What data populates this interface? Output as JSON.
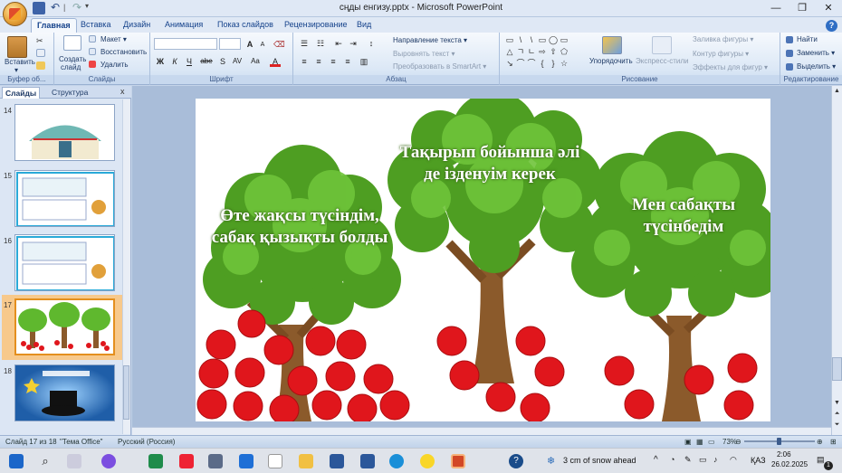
{
  "window": {
    "title": "сңды енгизу.pptx - Microsoft PowerPoint",
    "controls": [
      "—",
      "❐",
      "✕"
    ]
  },
  "quick_access": {
    "separator": "|",
    "more": "▾"
  },
  "tabs": [
    "Главная",
    "Вставка",
    "Дизайн",
    "Анимация",
    "Показ слайдов",
    "Рецензирование",
    "Вид"
  ],
  "active_tab": "Главная",
  "help": "?",
  "ribbon": {
    "clipboard": {
      "label": "Буфер об...",
      "paste": "Вставить",
      "paste_arrow": "▾"
    },
    "slides": {
      "label": "Слайды",
      "new_slide": "Создать",
      "new_slide_2": "слайд",
      "layout": "Макет ▾",
      "reset": "Восстановить",
      "delete": "Удалить"
    },
    "font": {
      "label": "Шрифт",
      "grow": "A",
      "shrink": "A",
      "bold": "Ж",
      "italic": "К",
      "underline": "Ч",
      "strike": "abe",
      "shadow": "S",
      "spacing": "AV",
      "case": "Aa",
      "color": "A"
    },
    "paragraph": {
      "label": "Абзац",
      "direction": "Направление текста ▾",
      "align_text": "Выровнять текст ▾",
      "smartart": "Преобразовать в SmartArt ▾"
    },
    "drawing": {
      "label": "Рисование",
      "arrange": "Упорядочить",
      "styles": "Экспресс-стили",
      "fill": "Заливка фигуры ▾",
      "outline": "Контур фигуры ▾",
      "effects": "Эффекты для фигур ▾",
      "shapes": [
        "▭",
        "\\",
        "\\",
        "▭",
        "◯",
        "▭",
        "△",
        "ㄱ",
        "ㄴ",
        "⇨",
        "⇧",
        "⬠",
        "↘",
        "⌒",
        "⌒",
        "{",
        "}",
        "☆"
      ]
    },
    "editing": {
      "label": "Редактирование",
      "find": "Найти",
      "replace": "Заменить ▾",
      "select": "Выделить ▾"
    }
  },
  "panel": {
    "tabs": [
      "Слайды",
      "Структура"
    ],
    "close": "x",
    "slides": [
      {
        "num": "14"
      },
      {
        "num": "15"
      },
      {
        "num": "16"
      },
      {
        "num": "17"
      },
      {
        "num": "18"
      }
    ]
  },
  "slide": {
    "tree_left": "Өте жақсы түсіндім, сабақ қызықты болды",
    "tree_middle": "Тақырып бойынша әлі де ізденуім керек",
    "tree_right": "Мен сабақты түсінбедім"
  },
  "status": {
    "slide_info": "Слайд 17 из 18",
    "theme": "\"Тема Office\"",
    "language": "Русский (Россия)",
    "zoom": "73%"
  },
  "taskbar": {
    "weather": "3 cm of snow ahead",
    "language": "ҚАЗ",
    "time": "2:06",
    "date": "26.02.2025",
    "notification_count": "1"
  },
  "colors": {
    "ribbon_text": "#15428b",
    "tree_foliage": "#5fb82e",
    "apple": "#e0161c",
    "trunk": "#8b5a2b"
  }
}
